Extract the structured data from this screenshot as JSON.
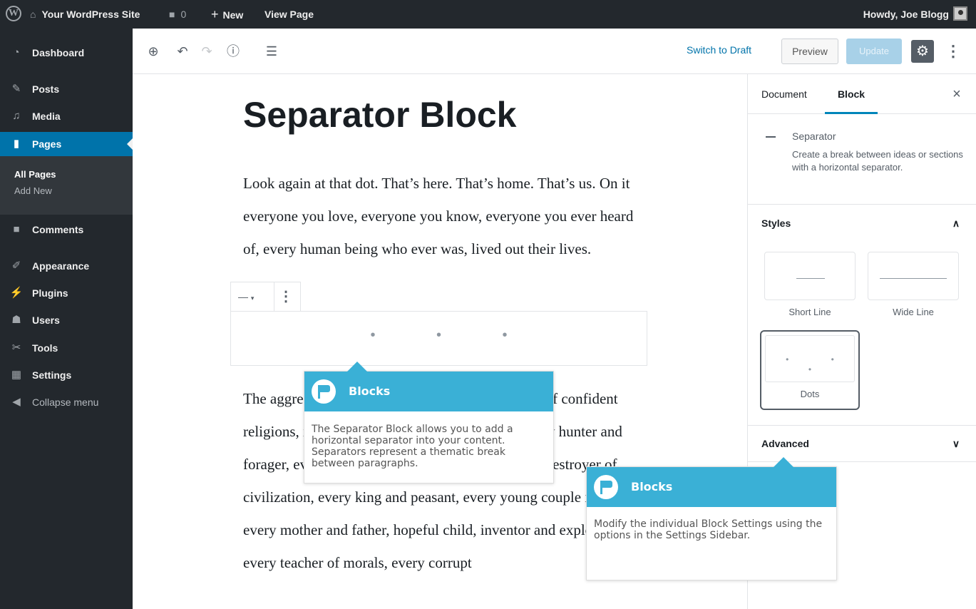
{
  "adminbar": {
    "site_name": "Your WordPress Site",
    "comments_count": "0",
    "new_label": "New",
    "view_page": "View Page",
    "howdy": "Howdy, Joe Blogg"
  },
  "menu": {
    "dashboard": "Dashboard",
    "posts": "Posts",
    "media": "Media",
    "pages": "Pages",
    "all_pages": "All Pages",
    "add_new": "Add New",
    "comments": "Comments",
    "appearance": "Appearance",
    "plugins": "Plugins",
    "users": "Users",
    "tools": "Tools",
    "settings": "Settings",
    "collapse": "Collapse menu"
  },
  "toolbar": {
    "switch_to_draft": "Switch to Draft",
    "preview": "Preview",
    "update": "Update"
  },
  "editor": {
    "title": "Separator Block",
    "paragraph1": "Look again at that dot. That’s here. That’s home. That’s us. On it everyone you love, everyone you know, everyone you ever heard of, every human being who ever was, lived out their lives.",
    "paragraph2": "The aggregate of our joy and suffering, thousands of confident religions, ideologies, and economic doctrines, every hunter and forager, every hero and coward, every creator and destroyer of civilization, every king and peasant, every young couple in love, every mother and father, hopeful child, inventor and explorer, every teacher of morals, every corrupt",
    "separator_dots": "• • •"
  },
  "sidebar": {
    "tab_document": "Document",
    "tab_block": "Block",
    "block_name": "Separator",
    "block_description": "Create a break between ideas or sections with a horizontal separator.",
    "styles_title": "Styles",
    "style_short": "Short Line",
    "style_wide": "Wide Line",
    "style_dots": "Dots",
    "advanced_title": "Advanced"
  },
  "tooltips": {
    "tip1_title": "Blocks",
    "tip1_body": "The Separator Block allows you to add a horizontal separator into your content. Separators represent a thematic break between paragraphs.",
    "tip2_title": "Blocks",
    "tip2_body": "Modify the individual Block Settings using the options in the Settings Sidebar."
  },
  "colors": {
    "admin_dark": "#23282d",
    "admin_blue": "#0073aa",
    "tooltip_blue": "#3ab0d6"
  }
}
